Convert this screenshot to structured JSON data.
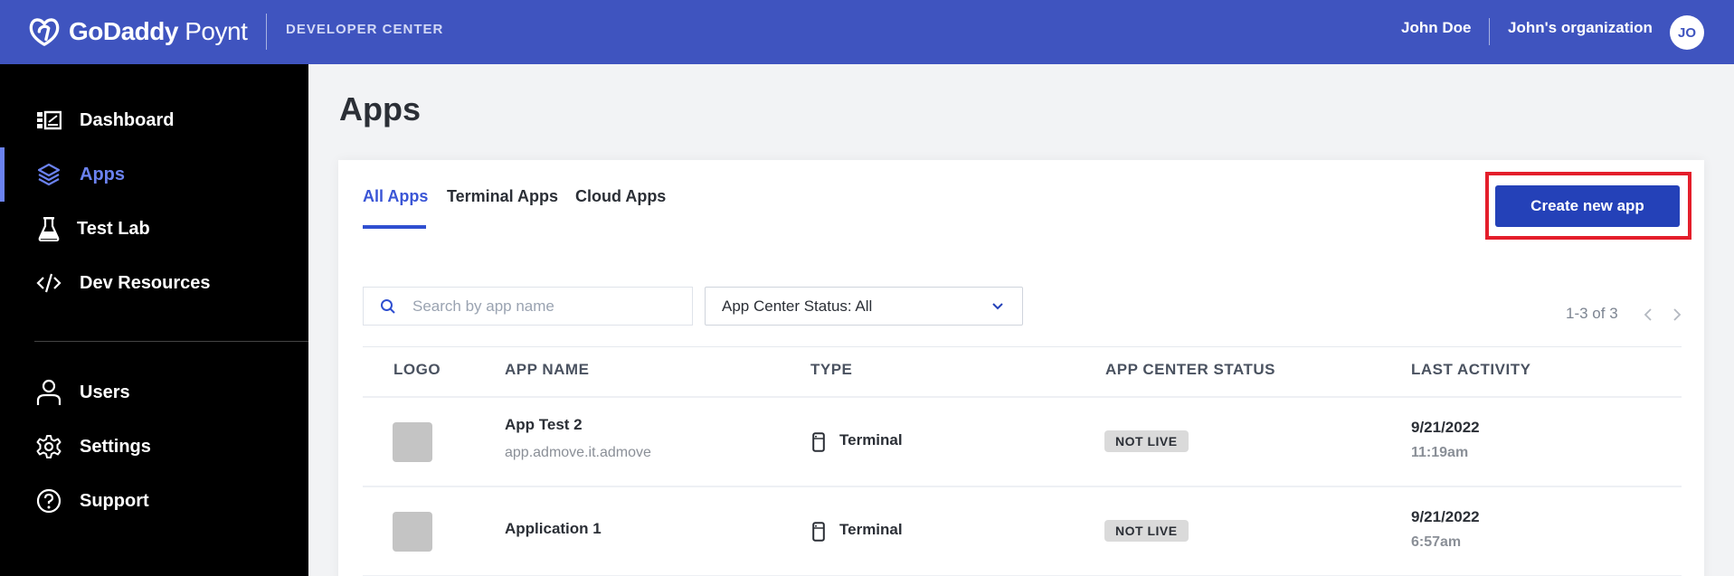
{
  "header": {
    "brand_bold": "GoDaddy",
    "brand_light": " Poynt",
    "section": "DEVELOPER CENTER",
    "user_name": "John Doe",
    "organization": "John's organization",
    "avatar_initials": "JO"
  },
  "sidebar": {
    "items": [
      {
        "label": "Dashboard",
        "icon": "dashboard-icon",
        "active": false
      },
      {
        "label": "Apps",
        "icon": "layers-icon",
        "active": true
      },
      {
        "label": "Test Lab",
        "icon": "flask-icon",
        "active": false
      },
      {
        "label": "Dev Resources",
        "icon": "code-icon",
        "active": false
      }
    ],
    "secondary_items": [
      {
        "label": "Users",
        "icon": "user-icon"
      },
      {
        "label": "Settings",
        "icon": "gear-icon"
      },
      {
        "label": "Support",
        "icon": "help-circle-icon"
      }
    ]
  },
  "main": {
    "title": "Apps",
    "tabs": [
      {
        "label": "All Apps",
        "active": true
      },
      {
        "label": "Terminal Apps",
        "active": false
      },
      {
        "label": "Cloud Apps",
        "active": false
      }
    ],
    "create_button": "Create new app",
    "search": {
      "placeholder": "Search by app name",
      "value": ""
    },
    "status_filter": {
      "selected": "App Center Status: All"
    },
    "pagination": {
      "range": "1-3 of 3"
    },
    "table": {
      "columns": [
        "LOGO",
        "APP NAME",
        "TYPE",
        "APP CENTER STATUS",
        "LAST ACTIVITY"
      ],
      "rows": [
        {
          "name": "App Test 2",
          "package": "app.admove.it.admove",
          "type": "Terminal",
          "status": "NOT LIVE",
          "date": "9/21/2022",
          "time": "11:19am"
        },
        {
          "name": "Application 1",
          "package": "",
          "type": "Terminal",
          "status": "NOT LIVE",
          "date": "9/21/2022",
          "time": "6:57am"
        }
      ]
    }
  },
  "colors": {
    "header_bg": "#3f54bf",
    "accent": "#6b82f0",
    "primary_button": "#2441b8",
    "highlight_border": "#e41e2b"
  }
}
